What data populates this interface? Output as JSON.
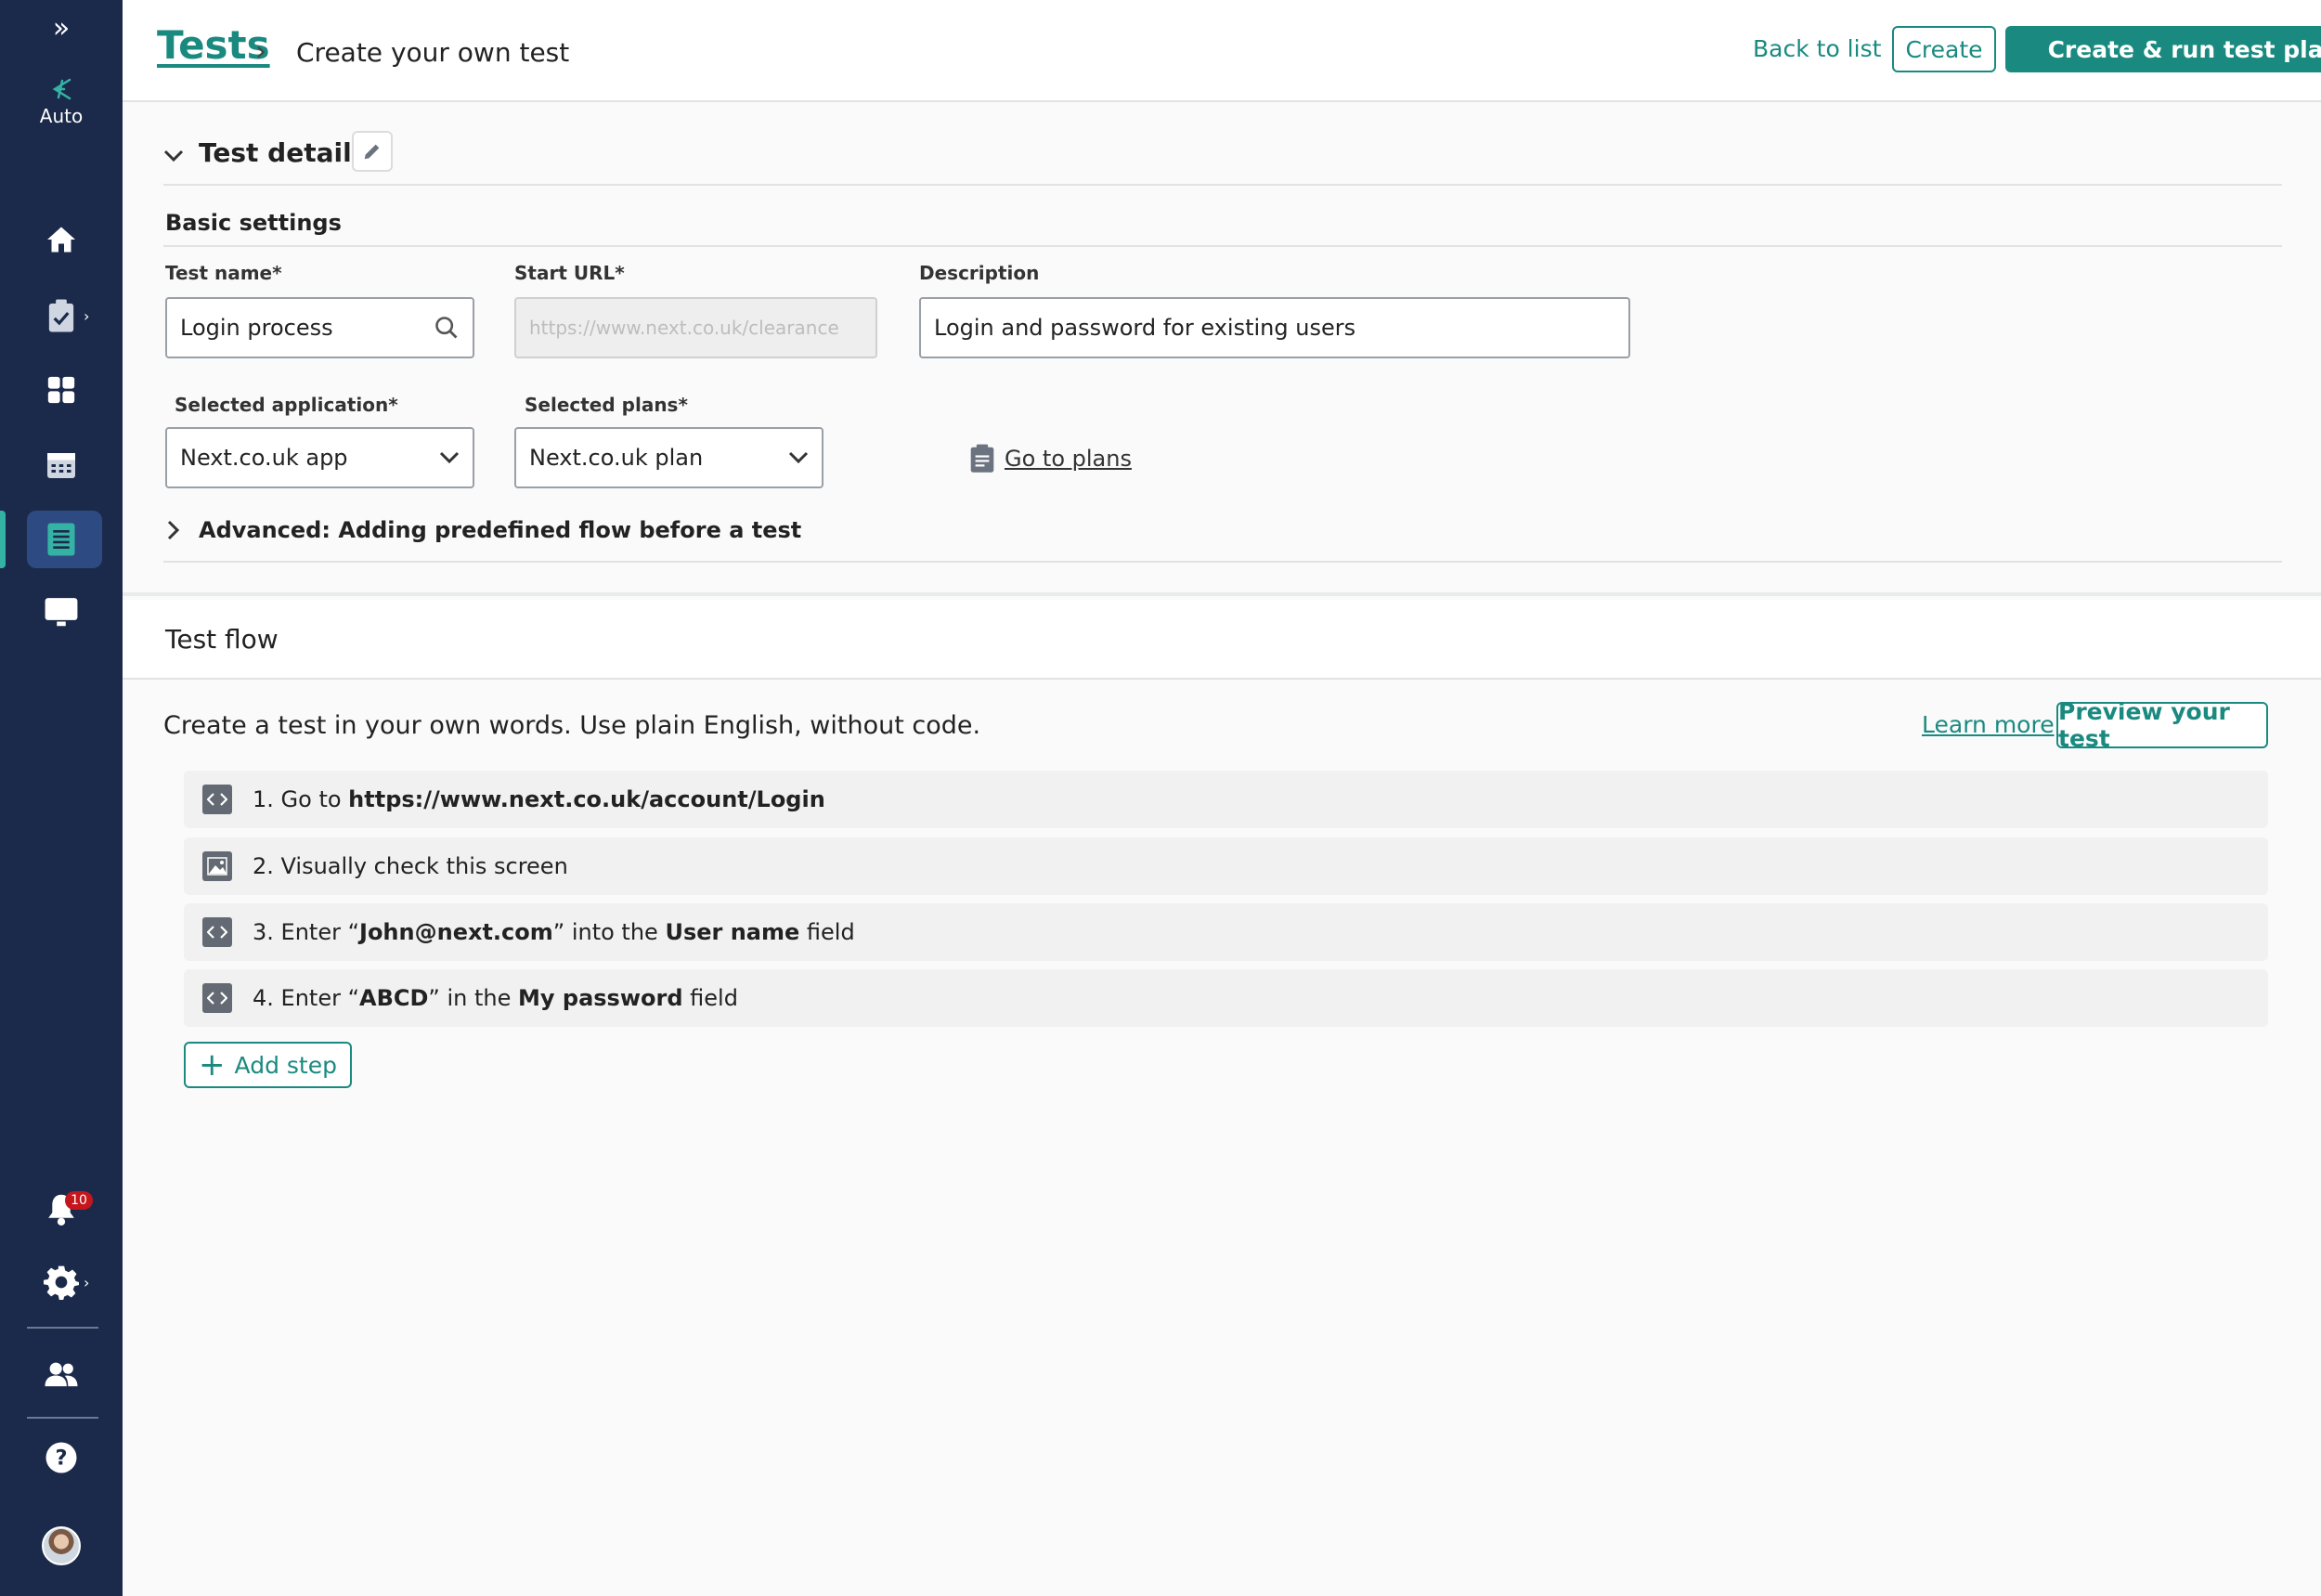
{
  "colors": {
    "accent": "#1a8a80",
    "sidebar_bg": "#1b2a4a",
    "sidebar_active": "#2e4a83",
    "badge": "#c4161c"
  },
  "sidebar": {
    "expand_icon": "double-chevron-right-icon",
    "logo_label": "Auto",
    "notification_count": "10",
    "items": [
      {
        "name": "home",
        "icon": "home-icon"
      },
      {
        "name": "clipboard",
        "icon": "clipboard-check-icon"
      },
      {
        "name": "dashboard",
        "icon": "grid-icon"
      },
      {
        "name": "calendar",
        "icon": "calendar-icon"
      },
      {
        "name": "tests",
        "icon": "list-document-icon",
        "active": true
      },
      {
        "name": "monitor",
        "icon": "monitor-icon"
      },
      {
        "name": "notifications",
        "icon": "bell-icon"
      },
      {
        "name": "settings",
        "icon": "gear-icon"
      },
      {
        "name": "users",
        "icon": "users-icon"
      },
      {
        "name": "help",
        "icon": "help-icon"
      },
      {
        "name": "profile",
        "icon": "avatar"
      }
    ]
  },
  "header": {
    "breadcrumb_root": "Tests",
    "breadcrumb_current": "Create your own test",
    "back_label": "Back to list",
    "create_label": "Create",
    "create_run_label": "Create & run test plan"
  },
  "details": {
    "title": "Test details:",
    "basic_settings": "Basic settings",
    "test_name_label": "Test name*",
    "test_name_value": "Login process",
    "start_url_label": "Start URL*",
    "start_url_placeholder": "https://www.next.co.uk/clearance",
    "description_label": "Description",
    "description_value": "Login and password for existing users",
    "app_label": "Selected application*",
    "app_value": "Next.co.uk app",
    "plans_label": "Selected plans*",
    "plans_value": "Next.co.uk plan",
    "go_to_plans": "Go to plans",
    "advanced_label": "Advanced: Adding predefined flow before a test"
  },
  "flow": {
    "title": "Test flow",
    "intro": "Create a test in your own words. Use plain English, without code.",
    "learn_more": "Learn more",
    "preview_label": "Preview your test",
    "add_step_label": "Add step",
    "steps": [
      {
        "icon": "code-icon",
        "p1": "1. Go to ",
        "b1": "https://www.next.co.uk/account/Login",
        "p2": "",
        "b2": "",
        "p3": ""
      },
      {
        "icon": "image-icon",
        "p1": "2. Visually check this screen",
        "b1": "",
        "p2": "",
        "b2": "",
        "p3": ""
      },
      {
        "icon": "code-icon",
        "p1": "3. Enter “",
        "b1": "John@next.com",
        "p2": "” into the ",
        "b2": "User name",
        "p3": " field"
      },
      {
        "icon": "code-icon",
        "p1": "4. Enter “",
        "b1": "ABCD",
        "p2": "” in the ",
        "b2": "My password",
        "p3": " field"
      }
    ]
  }
}
